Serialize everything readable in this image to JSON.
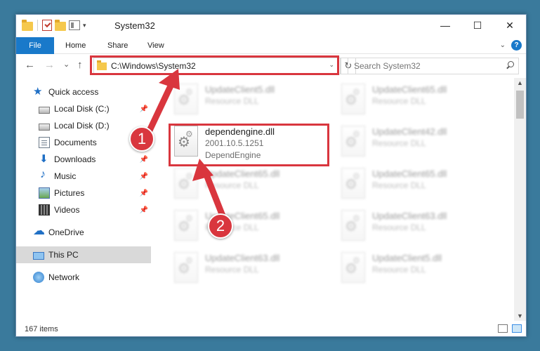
{
  "window": {
    "title": "System32",
    "controls": {
      "minimize": "—",
      "maximize": "☐",
      "close": "✕"
    }
  },
  "ribbon": {
    "tabs": [
      "File",
      "Home",
      "Share",
      "View"
    ],
    "help": "?"
  },
  "navigation": {
    "back": "←",
    "forward": "→",
    "recent": "⌄",
    "up": "↑",
    "address": "C:\\Windows\\System32",
    "search_placeholder": "Search System32"
  },
  "sidebar": {
    "items": [
      {
        "label": "Quick access",
        "icon": "quick-access-star-icon",
        "pinned": false
      },
      {
        "label": "Local Disk (C:)",
        "icon": "drive-icon",
        "pinned": true
      },
      {
        "label": "Local Disk (D:)",
        "icon": "drive-icon",
        "pinned": false
      },
      {
        "label": "Documents",
        "icon": "documents-icon",
        "pinned": true
      },
      {
        "label": "Downloads",
        "icon": "downloads-icon",
        "pinned": true
      },
      {
        "label": "Music",
        "icon": "music-icon",
        "pinned": true
      },
      {
        "label": "Pictures",
        "icon": "pictures-icon",
        "pinned": true
      },
      {
        "label": "Videos",
        "icon": "videos-icon",
        "pinned": true
      },
      {
        "label": "OneDrive",
        "icon": "onedrive-cloud-icon",
        "pinned": false
      },
      {
        "label": "This PC",
        "icon": "this-pc-icon",
        "pinned": false,
        "selected": true
      },
      {
        "label": "Network",
        "icon": "network-icon",
        "pinned": false
      }
    ]
  },
  "files": {
    "highlighted": {
      "name": "dependengine.dll",
      "version": "2001.10.5.1251",
      "description": "DependEngine"
    },
    "background": [
      {
        "name": "UpdateClient5.dll",
        "sub": "Resource DLL"
      },
      {
        "name": "UpdateClient65.dll",
        "sub": "Resource DLL"
      },
      {
        "name": "UpdateClient42.dll",
        "sub": "Resource DLL"
      },
      {
        "name": "UpdateClient65.dll",
        "sub": "Resource DLL"
      },
      {
        "name": "UpdateClient65.dll",
        "sub": "Resource DLL"
      },
      {
        "name": "UpdateClient65.dll",
        "sub": "Resource DLL"
      },
      {
        "name": "UpdateClient63.dll",
        "sub": "Resource DLL"
      },
      {
        "name": "UpdateClient63.dll",
        "sub": "Resource DLL"
      },
      {
        "name": "UpdateClient5.dll",
        "sub": "Resource DLL"
      }
    ]
  },
  "status": {
    "item_count": "167 items"
  },
  "callouts": {
    "step1": "1",
    "step2": "2"
  },
  "colors": {
    "accent": "#1979ca",
    "highlight": "#d9363e"
  }
}
